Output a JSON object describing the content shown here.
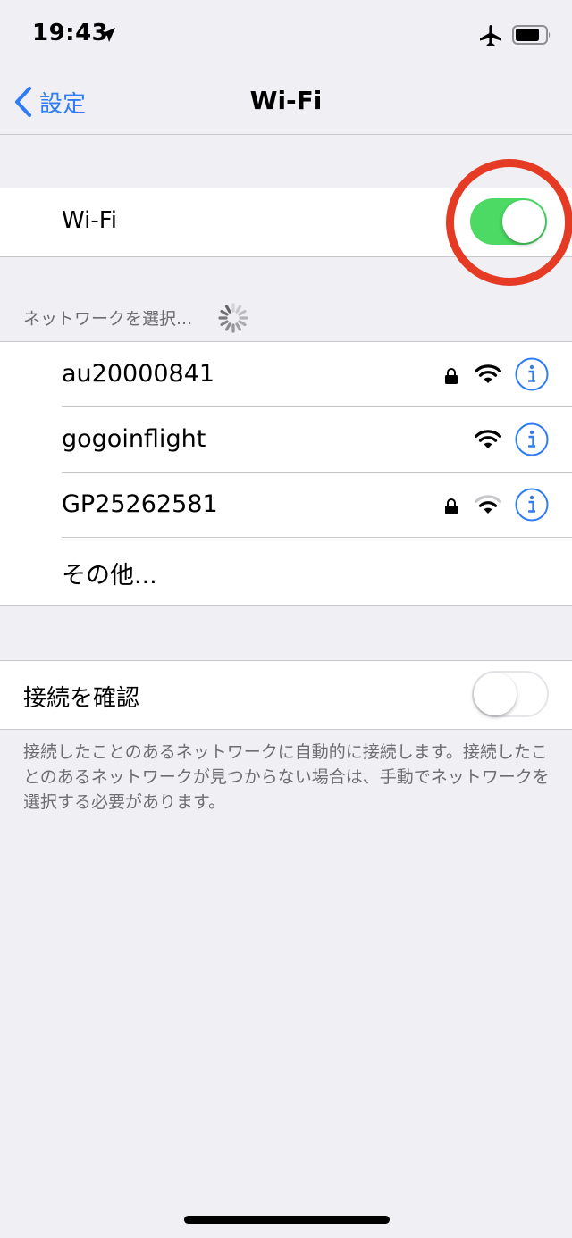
{
  "status_bar": {
    "time": "19:43",
    "icons": [
      "location-arrow-icon",
      "airplane-icon",
      "battery-icon"
    ]
  },
  "nav": {
    "back_label": "設定",
    "title": "Wi-Fi"
  },
  "wifi_row": {
    "label": "Wi-Fi",
    "toggle_on": true
  },
  "networks_section": {
    "header": "ネットワークを選択..."
  },
  "networks": [
    {
      "name": "au20000841",
      "locked": true,
      "signal": "full"
    },
    {
      "name": "gogoinflight",
      "locked": false,
      "signal": "full"
    },
    {
      "name": "GP25262581",
      "locked": true,
      "signal": "medium"
    }
  ],
  "other_label": "その他...",
  "ask_join": {
    "label": "接続を確認",
    "toggle_on": false
  },
  "footer": "接続したことのあるネットワークに自動的に接続します。接続したことのあるネットワークが見つからない場合は、手動でネットワークを選択する必要があります。",
  "colors": {
    "accent": "#2f7cf6",
    "toggle_on": "#4cd964",
    "highlight": "#e53b25",
    "background": "#efeff4"
  }
}
